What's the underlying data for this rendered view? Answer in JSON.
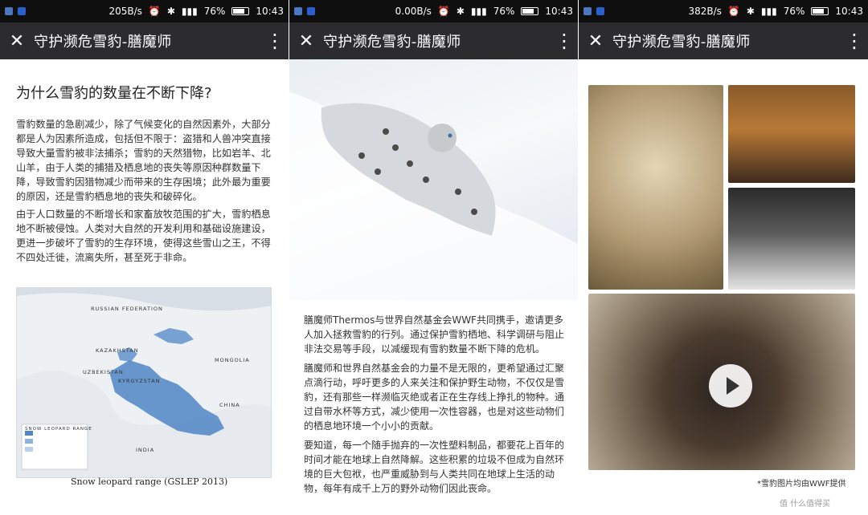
{
  "panels": [
    {
      "status": {
        "speed": "205B/s",
        "battery": "76%",
        "time": "10:43"
      },
      "header": {
        "title": "守护濒危雪豹-膳魔师"
      },
      "article": {
        "heading": "为什么雪豹的数量在不断下降?",
        "p1": "雪豹数量的急剧减少，除了气候变化的自然因素外，大部分都是人为因素所造成，包括但不限于：盗猎和人兽冲突直接导致大量雪豹被非法捕杀；雪豹的天然猎物，比如岩羊、北山羊，由于人类的捕猎及栖息地的丧失等原因种群数量下降，导致雪豹因猎物减少而带来的生存困境；此外最为重要的原因，还是雪豹栖息地的丧失和破碎化。",
        "p2": "由于人口数量的不断增长和家畜放牧范围的扩大，雪豹栖息地不断被侵蚀。人类对大自然的开发利用和基础设施建设，更进一步破坏了雪豹的生存环境，使得这些雪山之王，不得不四处迁徙，流离失所，甚至死于非命。",
        "map_labels": {
          "russia": "RUSSIAN FEDERATION",
          "kazakhstan": "KAZAKHSTAN",
          "mongolia": "MONGOLIA",
          "uzbekistan": "UZBEKISTAN",
          "kyrgyzstan": "KYRGYZSTAN",
          "china": "CHINA",
          "india": "INDIA",
          "legend_title": "SNOW LEOPARD RANGE"
        },
        "map_caption": "Snow leopard range (GSLEP 2013)"
      }
    },
    {
      "status": {
        "speed": "0.00B/s",
        "battery": "76%",
        "time": "10:43"
      },
      "header": {
        "title": "守护濒危雪豹-膳魔师"
      },
      "article": {
        "p1": "膳魔师Thermos与世界自然基金会WWF共同携手，邀请更多人加入拯救雪豹的行列。通过保护雪豹栖地、科学调研与阻止非法交易等手段，以减缓现有雪豹数量不断下降的危机。",
        "p2": "膳魔师和世界自然基金会的力量不是无限的，更希望通过汇聚点滴行动，呼吁更多的人来关注和保护野生动物，不仅仅是雪豹，还有那些一样濒临灭绝或者正在生存线上挣扎的物种。通过自带水杯等方式，减少使用一次性容器，也是对这些动物们的栖息地环境一个小小的贡献。",
        "p3": "要知道，每一个随手抛弃的一次性塑料制品，都要花上百年的时间才能在地球上自然降解。这些积累的垃圾不但成为自然环境的巨大包袱，也严重威胁到与人类共同在地球上生活的动物，每年有成千上万的野外动物们因此丧命。"
      }
    },
    {
      "status": {
        "speed": "382B/s",
        "battery": "76%",
        "time": "10:43"
      },
      "header": {
        "title": "守护濒危雪豹-膳魔师"
      },
      "gallery": {
        "credit": "*雪豹图片均由WWF提供",
        "watermark": "值 什么值得买"
      }
    }
  ],
  "icons": {
    "close": "close-icon",
    "more": "more-vertical-icon",
    "play": "play-icon"
  },
  "colors": {
    "statusbar": "#0f0f10",
    "topbar": "#2c2c2e",
    "text": "#333333",
    "map_range": "#4f86c6"
  }
}
